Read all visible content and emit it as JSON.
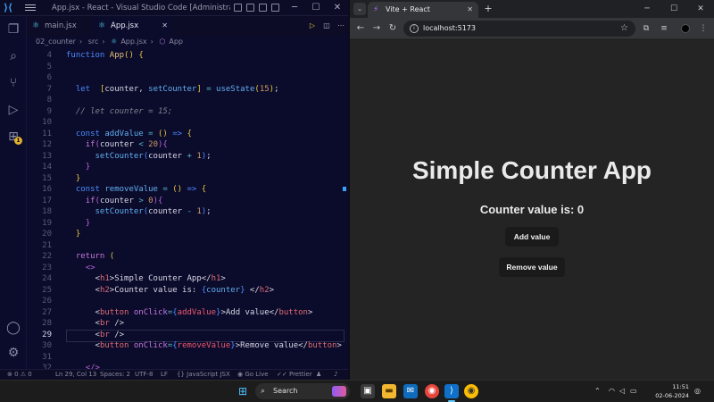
{
  "vscode": {
    "title": "App.jsx - React - Visual Studio Code [Administrator]",
    "tabs": [
      {
        "label": "main.jsx",
        "active": false
      },
      {
        "label": "App.jsx",
        "active": true
      }
    ],
    "breadcrumbs": [
      "02_counter",
      "src",
      "App.jsx",
      "App"
    ],
    "activity_badge": "1",
    "status": {
      "errors": "0",
      "warnings": "0",
      "position": "Ln 29, Col 13",
      "spaces": "Spaces: 2",
      "encoding": "UTF-8",
      "eol": "LF",
      "language": "JavaScript JSX",
      "golive": "Go Live",
      "prettier": "Prettier"
    },
    "current_line": 29,
    "code_lines": [
      {
        "n": "4",
        "html": "<span class='kw2'>function</span> <span class='fn2'>App</span><span class='br'>()</span> <span class='br'>{</span>"
      },
      {
        "n": "5",
        "html": ""
      },
      {
        "n": "6",
        "html": ""
      },
      {
        "n": "7",
        "html": "  <span class='kw2'>let</span>  <span class='br'>[</span>counter, <span class='fn'>setCounter</span><span class='br'>]</span> <span class='op'>=</span> <span class='fn'>useState</span><span class='br'>(</span><span class='num'>15</span><span class='br'>)</span>;"
      },
      {
        "n": "8",
        "html": ""
      },
      {
        "n": "9",
        "html": "  <span class='cm'>// let counter = 15;</span>"
      },
      {
        "n": "10",
        "html": ""
      },
      {
        "n": "11",
        "html": "  <span class='kw2'>const</span> <span class='fn'>addValue</span> <span class='op'>=</span> <span class='br'>()</span> <span class='kw2'>=&gt;</span> <span class='br'>{</span>"
      },
      {
        "n": "12",
        "html": "    <span class='kw'>if</span><span class='pl'>(</span>counter <span class='op'>&lt;</span> <span class='num'>20</span><span class='pl'>)</span><span class='pl'>{</span>"
      },
      {
        "n": "13",
        "html": "      <span class='fn'>setCounter</span><span class='kw2'>(</span>counter <span class='op'>+</span> <span class='num'>1</span><span class='kw2'>)</span>;"
      },
      {
        "n": "14",
        "html": "    <span class='pl'>}</span>"
      },
      {
        "n": "15",
        "html": "  <span class='br'>}</span>"
      },
      {
        "n": "16",
        "html": "  <span class='kw2'>const</span> <span class='fn'>removeValue</span> <span class='op'>=</span> <span class='br'>()</span> <span class='kw2'>=&gt;</span> <span class='br'>{</span>"
      },
      {
        "n": "17",
        "html": "    <span class='kw'>if</span><span class='pl'>(</span>counter <span class='op'>&gt;</span> <span class='num'>0</span><span class='pl'>)</span><span class='pl'>{</span>"
      },
      {
        "n": "18",
        "html": "      <span class='fn'>setCounter</span><span class='kw2'>(</span>counter <span class='op'>-</span> <span class='num'>1</span><span class='kw2'>)</span>;"
      },
      {
        "n": "19",
        "html": "    <span class='pl'>}</span>"
      },
      {
        "n": "20",
        "html": "  <span class='br'>}</span>"
      },
      {
        "n": "21",
        "html": ""
      },
      {
        "n": "22",
        "html": "  <span class='kw'>return</span> <span class='br'>(</span>"
      },
      {
        "n": "23",
        "html": "    <span class='pl'>&lt;&gt;</span>"
      },
      {
        "n": "24",
        "html": "      &lt;<span class='tag'>h1</span>&gt;Simple Counter App&lt;/<span class='tag'>h1</span>&gt;"
      },
      {
        "n": "25",
        "html": "      &lt;<span class='tag'>h2</span>&gt;Counter value is: <span class='kw2'>{</span><span class='fn'>counter</span><span class='kw2'>}</span> &lt;/<span class='tag'>h2</span>&gt;"
      },
      {
        "n": "26",
        "html": ""
      },
      {
        "n": "27",
        "html": "      &lt;<span class='tag'>button</span> <span class='attr'>onClick</span><span class='op'>=</span><span class='kw2'>{</span><span class='vr'>addValue</span><span class='kw2'>}</span>&gt;Add value&lt;/<span class='tag'>button</span>&gt;"
      },
      {
        "n": "28",
        "html": "      &lt;<span class='tag'>br</span> /&gt;"
      },
      {
        "n": "29",
        "html": "      &lt;<span class='tag'>br</span> /&gt;"
      },
      {
        "n": "30",
        "html": "      &lt;<span class='tag'>button</span> <span class='attr'>onClick</span><span class='op'>=</span><span class='kw2'>{</span><span class='vr'>removeValue</span><span class='kw2'>}</span>&gt;Remove value&lt;/<span class='tag'>button</span>&gt;"
      },
      {
        "n": "31",
        "html": ""
      },
      {
        "n": "32",
        "html": "    <span class='pl'>&lt;/&gt;</span>"
      }
    ]
  },
  "browser": {
    "tab_title": "Vite + React",
    "url": "localhost:5173",
    "page": {
      "heading": "Simple Counter App",
      "counter_text": "Counter value is: 0",
      "add_button": "Add value",
      "remove_button": "Remove value"
    }
  },
  "taskbar": {
    "search_label": "Search",
    "time": "11:51",
    "date": "02-06-2024"
  }
}
